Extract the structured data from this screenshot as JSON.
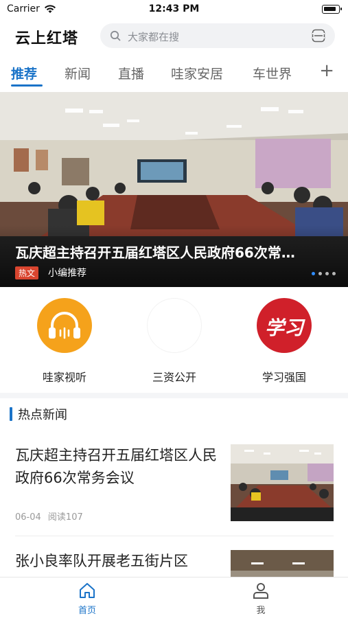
{
  "status_bar": {
    "carrier": "Carrier",
    "time": "12:43 PM"
  },
  "header": {
    "title": "云上红塔",
    "search_placeholder": "大家都在搜"
  },
  "tabs": [
    {
      "label": "推荐",
      "active": true
    },
    {
      "label": "新闻",
      "active": false
    },
    {
      "label": "直播",
      "active": false
    },
    {
      "label": "哇家安居",
      "active": false
    },
    {
      "label": "车世界",
      "active": false
    }
  ],
  "tab_add_label": "+",
  "banner": {
    "title": "瓦庆超主持召开五届红塔区人民政府66次常…",
    "tag": "热文",
    "source": "小编推荐",
    "page_count": 4,
    "current_page": 1
  },
  "shortcuts": [
    {
      "label": "哇家视听",
      "icon": "headphones-icon"
    },
    {
      "label": "三资公开",
      "icon": "blank-icon"
    },
    {
      "label": "学习强国",
      "icon": "xuexi-icon",
      "icon_text": "学习"
    }
  ],
  "section": {
    "title": "热点新闻"
  },
  "news": [
    {
      "title": "瓦庆超主持召开五届红塔区人民政府66次常务会议",
      "date": "06-04",
      "reads": "阅读107"
    },
    {
      "title": "张小良率队开展老五街片区",
      "date": "",
      "reads": ""
    }
  ],
  "bottom_nav": [
    {
      "label": "首页",
      "icon": "home-icon",
      "active": true
    },
    {
      "label": "我",
      "icon": "user-icon",
      "active": false
    }
  ],
  "colors": {
    "accent": "#1a73c8",
    "hot_tag": "#d9452f",
    "xuexi_red": "#d0202a",
    "headphone_orange": "#f5a21b"
  }
}
